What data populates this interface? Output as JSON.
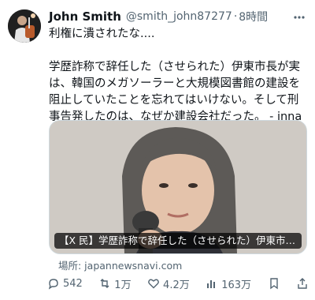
{
  "tweet": {
    "display_name": "John Smith",
    "handle": "@smith_john87277",
    "separator": "·",
    "time": "8時間",
    "body": "利権に潰されたな....\n\n学歴詐称で辞任した（させられた）伊東市長が実は、韓国のメガソーラーと大規模図書館の建設を阻止していたことを忘れてはいけない。そして刑事告発したのは、なぜか建設会社だった。 - jnnavi"
  },
  "media": {
    "caption": "【X 民】学歴詐称で辞任した（させられた）伊東市長…"
  },
  "source": {
    "label": "場所: japannewsnavi.com"
  },
  "actions": {
    "replies": "542",
    "retweets": "1万",
    "likes": "4.2万",
    "views": "163万"
  }
}
